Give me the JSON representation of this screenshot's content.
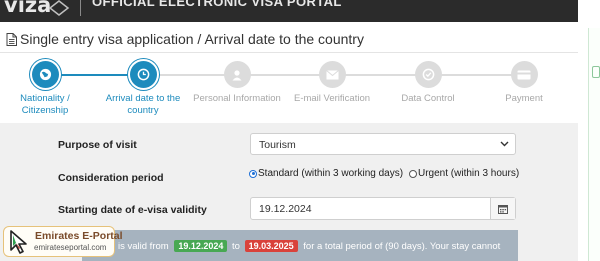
{
  "header": {
    "logo_text": "viza",
    "portal_title": "OFFICIAL ELECTRONIC VISA PORTAL"
  },
  "page_title": "Single entry visa application / Arrival date to the country",
  "steps": [
    {
      "label": "Nationality /\nCitizenship",
      "icon": "globe-icon",
      "state": "active"
    },
    {
      "label": "Arrival date to the\ncountry",
      "icon": "clock-icon",
      "state": "active"
    },
    {
      "label": "Personal Information",
      "icon": "user-icon",
      "state": "inactive"
    },
    {
      "label": "E-mail Verification",
      "icon": "envelope-icon",
      "state": "inactive"
    },
    {
      "label": "Data Control",
      "icon": "check-circle-icon",
      "state": "inactive"
    },
    {
      "label": "Payment",
      "icon": "credit-card-icon",
      "state": "inactive"
    }
  ],
  "form": {
    "purpose_label": "Purpose of visit",
    "purpose_value": "Tourism",
    "period_label": "Consideration period",
    "period_options": [
      {
        "label": "Standard (within 3 working days)",
        "selected": true
      },
      {
        "label": "Urgent (within 3 hours)",
        "selected": false
      }
    ],
    "start_label": "Starting date of e-visa validity",
    "start_value": "19.12.2024"
  },
  "alert": {
    "prefix": "is valid from",
    "from_date": "19.12.2024",
    "to_word": "to",
    "to_date": "19.03.2025",
    "suffix": "for a total period of (90 days). Your stay cannot"
  },
  "watermark": {
    "name": "Emirates E-Portal",
    "url": "emirateseportal.com"
  },
  "colors": {
    "accent": "#1d8bbd",
    "inactive": "#dcdcdc",
    "alert_bg": "#a6b3bf",
    "green_badge": "#48a853",
    "red_badge": "#d9423b"
  }
}
